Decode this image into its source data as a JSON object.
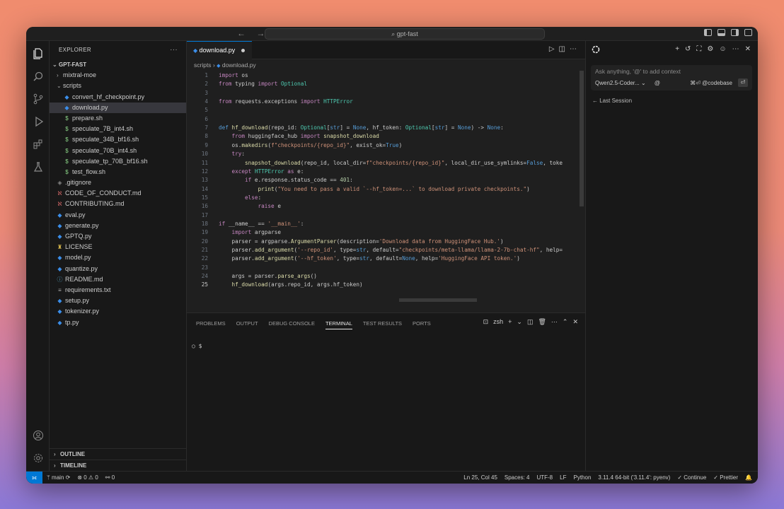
{
  "window": {
    "search_label": "gpt-fast",
    "nav_arrows": "← →"
  },
  "sidebar": {
    "header": "EXPLORER",
    "more": "···",
    "project": "GPT-FAST",
    "items": [
      {
        "label": "mixtral-moe",
        "kind": "folder-closed",
        "indent": 1
      },
      {
        "label": "scripts",
        "kind": "folder-open",
        "indent": 1
      },
      {
        "label": "convert_hf_checkpoint.py",
        "kind": "py",
        "indent": 2
      },
      {
        "label": "download.py",
        "kind": "py",
        "indent": 2,
        "selected": true
      },
      {
        "label": "prepare.sh",
        "kind": "sh",
        "indent": 2
      },
      {
        "label": "speculate_7B_int4.sh",
        "kind": "sh",
        "indent": 2
      },
      {
        "label": "speculate_34B_bf16.sh",
        "kind": "sh",
        "indent": 2
      },
      {
        "label": "speculate_70B_int4.sh",
        "kind": "sh",
        "indent": 2
      },
      {
        "label": "speculate_tp_70B_bf16.sh",
        "kind": "sh",
        "indent": 2
      },
      {
        "label": "test_flow.sh",
        "kind": "sh",
        "indent": 2
      },
      {
        "label": ".gitignore",
        "kind": "git",
        "indent": 1
      },
      {
        "label": "CODE_OF_CONDUCT.md",
        "kind": "md-red",
        "indent": 1
      },
      {
        "label": "CONTRIBUTING.md",
        "kind": "md-red",
        "indent": 1
      },
      {
        "label": "eval.py",
        "kind": "py",
        "indent": 1
      },
      {
        "label": "generate.py",
        "kind": "py",
        "indent": 1
      },
      {
        "label": "GPTQ.py",
        "kind": "py",
        "indent": 1
      },
      {
        "label": "LICENSE",
        "kind": "license",
        "indent": 1
      },
      {
        "label": "model.py",
        "kind": "py",
        "indent": 1
      },
      {
        "label": "quantize.py",
        "kind": "py",
        "indent": 1
      },
      {
        "label": "README.md",
        "kind": "md",
        "indent": 1
      },
      {
        "label": "requirements.txt",
        "kind": "txt",
        "indent": 1
      },
      {
        "label": "setup.py",
        "kind": "py",
        "indent": 1
      },
      {
        "label": "tokenizer.py",
        "kind": "py",
        "indent": 1
      },
      {
        "label": "tp.py",
        "kind": "py",
        "indent": 1
      }
    ],
    "outline": "OUTLINE",
    "timeline": "TIMELINE"
  },
  "editor": {
    "tab_label": "download.py",
    "breadcrumb_folder": "scripts",
    "breadcrumb_file": "download.py",
    "breadcrumb_sep": "›",
    "current_line": 25,
    "lines": [
      "import os",
      "from typing import Optional",
      "",
      "from requests.exceptions import HTTPError",
      "",
      "",
      "def hf_download(repo_id: Optional[str] = None, hf_token: Optional[str] = None) -> None:",
      "    from huggingface_hub import snapshot_download",
      "    os.makedirs(f\"checkpoints/{repo_id}\", exist_ok=True)",
      "    try:",
      "        snapshot_download(repo_id, local_dir=f\"checkpoints/{repo_id}\", local_dir_use_symlinks=False, toke",
      "    except HTTPError as e:",
      "        if e.response.status_code == 401:",
      "            print(\"You need to pass a valid `--hf_token=...` to download private checkpoints.\")",
      "        else:",
      "            raise e",
      "",
      "if __name__ == '__main__':",
      "    import argparse",
      "    parser = argparse.ArgumentParser(description='Download data from HuggingFace Hub.')",
      "    parser.add_argument('--repo_id', type=str, default=\"checkpoints/meta-llama/llama-2-7b-chat-hf\", help=",
      "    parser.add_argument('--hf_token', type=str, default=None, help='HuggingFace API token.')",
      "",
      "    args = parser.parse_args()",
      "    hf_download(args.repo_id, args.hf_token)"
    ]
  },
  "panel": {
    "tabs": [
      "PROBLEMS",
      "OUTPUT",
      "DEBUG CONSOLE",
      "TERMINAL",
      "TEST RESULTS",
      "PORTS"
    ],
    "active_tab": "TERMINAL",
    "shell": "zsh",
    "prompt": "○ $"
  },
  "chat": {
    "placeholder": "Ask anything, '@' to add context",
    "model": "Qwen2.5-Coder...",
    "at": "@",
    "codebase": "⌘⏎ @codebase",
    "send": "⏎",
    "last_session": "← Last Session"
  },
  "status": {
    "branch": "main",
    "problems": "⊗ 0 ⚠ 0",
    "ports": "⚯ 0",
    "position": "Ln 25, Col 45",
    "spaces": "Spaces: 4",
    "encoding": "UTF-8",
    "eol": "LF",
    "language": "Python",
    "interpreter": "3.11.4 64-bit ('3.11.4': pyenv)",
    "continue": "✓ Continue",
    "prettier": "✓ Prettier"
  },
  "colors": {
    "accent": "#0078d4",
    "keyword": "#c586c0",
    "function": "#dcdcaa",
    "string": "#ce9178",
    "python_icon": "#3b8eea",
    "shell_icon": "#89d185"
  }
}
